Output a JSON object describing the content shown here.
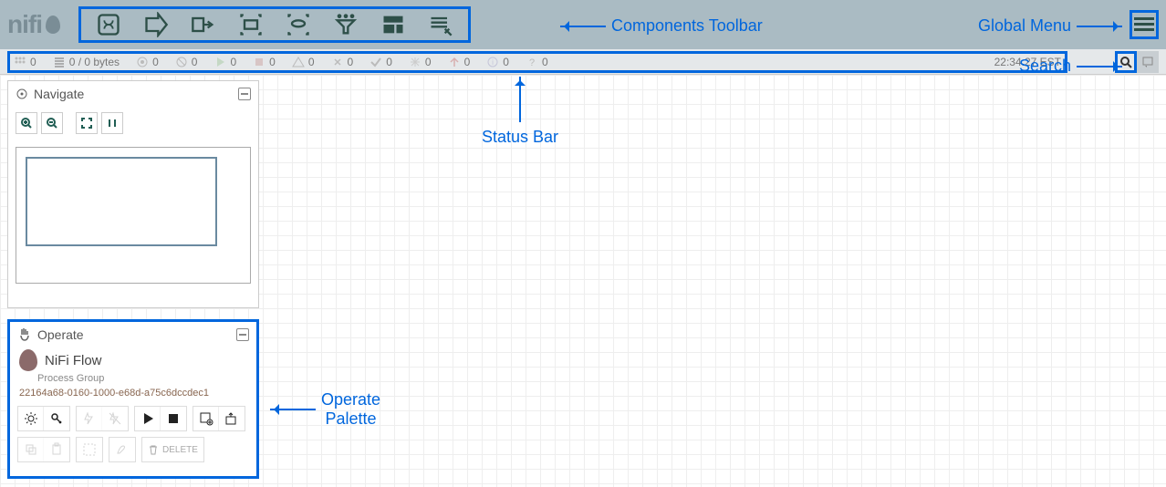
{
  "annotations": {
    "components_toolbar": "Components Toolbar",
    "global_menu": "Global Menu",
    "status_bar": "Status Bar",
    "search": "Search",
    "operate_palette": "Operate\nPalette"
  },
  "logo_text": "nifi",
  "status": {
    "threads": "0",
    "queue": "0 / 0 bytes",
    "transmitting": "0",
    "not_transmitting": "0",
    "running": "0",
    "stopped": "0",
    "invalid": "0",
    "disabled": "0",
    "up_to_date": "0",
    "locally_modified": "0",
    "stale": "0",
    "sync_failure": "0",
    "unknown": "0",
    "refresh_time": "22:34:27 EST"
  },
  "navigate": {
    "title": "Navigate"
  },
  "operate": {
    "title": "Operate",
    "flow_name": "NiFi Flow",
    "flow_type": "Process Group",
    "flow_id": "22164a68-0160-1000-e68d-a75c6dccdec1",
    "delete_label": "DELETE"
  }
}
